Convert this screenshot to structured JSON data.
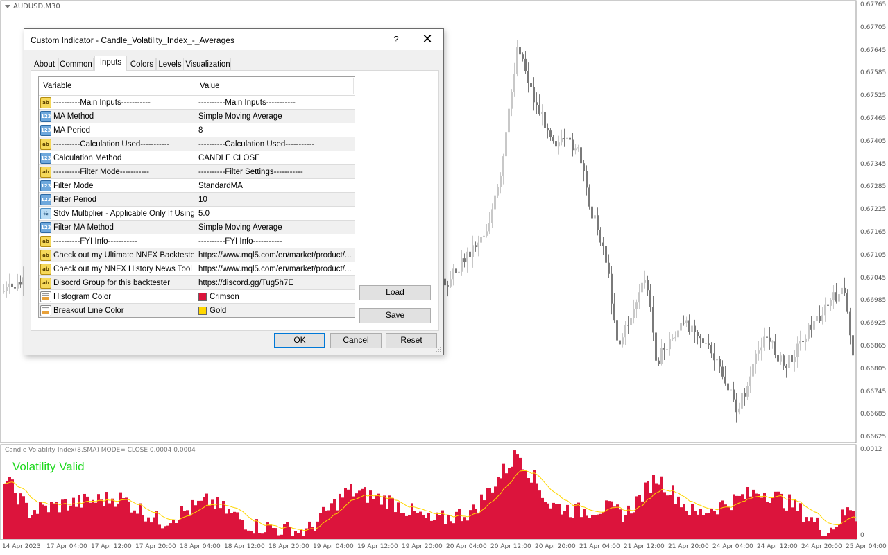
{
  "chart": {
    "symbol": "AUDUSD,M30",
    "price_labels": [
      "0.67765",
      "0.67705",
      "0.67645",
      "0.67585",
      "0.67525",
      "0.67465",
      "0.67405",
      "0.67345",
      "0.67285",
      "0.67225",
      "0.67165",
      "0.67105",
      "0.67045",
      "0.66985",
      "0.66925",
      "0.66865",
      "0.66805",
      "0.66745",
      "0.66685",
      "0.66625"
    ],
    "time_labels": [
      "14 Apr 2023",
      "17 Apr 04:00",
      "17 Apr 12:00",
      "17 Apr 20:00",
      "18 Apr 04:00",
      "18 Apr 12:00",
      "18 Apr 20:00",
      "19 Apr 04:00",
      "19 Apr 12:00",
      "19 Apr 20:00",
      "20 Apr 04:00",
      "20 Apr 12:00",
      "20 Apr 20:00",
      "21 Apr 04:00",
      "21 Apr 12:00",
      "21 Apr 20:00",
      "24 Apr 04:00",
      "24 Apr 12:00",
      "24 Apr 20:00",
      "25 Apr 04:00"
    ],
    "colors": {
      "bull": "#c8c8c8",
      "bear": "#7a7a7a",
      "background": "#ffffff"
    }
  },
  "indicator": {
    "header": "Candle Volatility Index(8,SMA) MODE= CLOSE 0.0004 0.0004",
    "status_text": "Volatility Valid",
    "scale_top": "0.0012",
    "scale_bottom": "0",
    "colors": {
      "histogram": "#dc143c",
      "line": "#ffd700",
      "status": "#1fd91f"
    }
  },
  "dialog": {
    "title": "Custom Indicator - Candle_Volatility_Index_-_Averages",
    "help_label": "?",
    "close_label": "✕",
    "tabs": [
      {
        "label": "About"
      },
      {
        "label": "Common"
      },
      {
        "label": "Inputs",
        "active": true
      },
      {
        "label": "Colors"
      },
      {
        "label": "Levels"
      },
      {
        "label": "Visualization"
      }
    ],
    "columns": {
      "variable": "Variable",
      "value": "Value"
    },
    "rows": [
      {
        "icon": "ab",
        "variable": "----------Main Inputs-----------",
        "value": "----------Main Inputs-----------"
      },
      {
        "icon": "123",
        "variable": "MA Method",
        "value": "Simple Moving Average"
      },
      {
        "icon": "123",
        "variable": "MA Period",
        "value": "8"
      },
      {
        "icon": "ab",
        "variable": "----------Calculation Used-----------",
        "value": "----------Calculation Used-----------"
      },
      {
        "icon": "123",
        "variable": "Calculation Method",
        "value": "CANDLE CLOSE"
      },
      {
        "icon": "ab",
        "variable": "----------Filter Mode-----------",
        "value": "----------Filter Settings-----------"
      },
      {
        "icon": "123",
        "variable": "Filter Mode",
        "value": "StandardMA"
      },
      {
        "icon": "123",
        "variable": "Filter Period",
        "value": "10"
      },
      {
        "icon": "½",
        "variable": "Stdv Multiplier - Applicable Only If Using ...",
        "value": "5.0"
      },
      {
        "icon": "123",
        "variable": "Filter MA Method",
        "value": "Simple Moving Average"
      },
      {
        "icon": "ab",
        "variable": "----------FYI Info-----------",
        "value": "----------FYI Info-----------"
      },
      {
        "icon": "ab",
        "variable": "Check out my Ultimate NNFX Backtester...",
        "value": "https://www.mql5.com/en/market/product/..."
      },
      {
        "icon": "ab",
        "variable": "Check out my NNFX History News Tool ...",
        "value": "https://www.mql5.com/en/market/product/..."
      },
      {
        "icon": "ab",
        "variable": "Disocrd Group for this backtester",
        "value": "https://discord.gg/Tug5h7E"
      },
      {
        "icon": "color",
        "variable": "Histogram Color",
        "value": "Crimson",
        "swatch": "#dc143c"
      },
      {
        "icon": "color",
        "variable": "Breakout Line Color",
        "value": "Gold",
        "swatch": "#ffd700"
      }
    ],
    "buttons": {
      "load": "Load",
      "save": "Save",
      "ok": "OK",
      "cancel": "Cancel",
      "reset": "Reset"
    }
  }
}
